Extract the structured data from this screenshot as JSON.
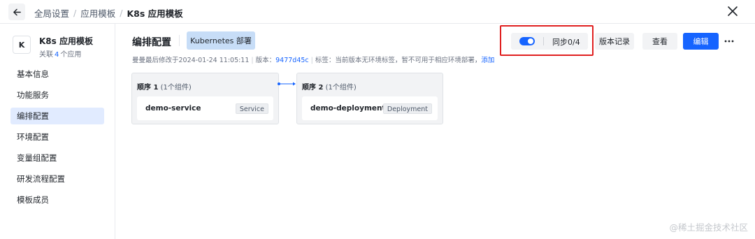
{
  "header": {
    "breadcrumbs": [
      "全局设置",
      "应用模板"
    ],
    "current": "K8s 应用模板",
    "back_icon": "arrow-left-icon",
    "close_icon": "close-icon"
  },
  "sidebar": {
    "app_avatar_letter": "K",
    "app_name": "K8s 应用模板",
    "app_meta_prefix": "关联",
    "app_meta_count": "4",
    "app_meta_suffix": "个应用",
    "items": [
      {
        "label": "基本信息",
        "active": false
      },
      {
        "label": "功能服务",
        "active": false
      },
      {
        "label": "编排配置",
        "active": true
      },
      {
        "label": "环境配置",
        "active": false
      },
      {
        "label": "变量组配置",
        "active": false
      },
      {
        "label": "研发流程配置",
        "active": false
      },
      {
        "label": "模板成员",
        "active": false
      }
    ]
  },
  "main": {
    "title": "编排配置",
    "tag": "Kubernetes 部署",
    "meta": {
      "modified": "曼曼最后修改于2024-01-24 11:05:11",
      "version_label": "版本：",
      "version_value": "9477d45c",
      "tags_label": "标签：",
      "tags_text": "当前版本无环境标签，暂不可用于相应环境部署，",
      "add_link": "添加"
    },
    "toolbar": {
      "sync_enabled": true,
      "sync_label": "同步0/4",
      "history_label": "版本记录",
      "view_label": "查看",
      "edit_label": "编辑",
      "more_icon": "more-horizontal-icon"
    },
    "stages": [
      {
        "title": "顺序 1",
        "count": "(1个组件)",
        "component": "demo-service",
        "kind": "Service"
      },
      {
        "title": "顺序 2",
        "count": "(1个组件)",
        "component": "demo-deployment",
        "kind": "Deployment"
      }
    ]
  },
  "watermark": "@稀土掘金技术社区",
  "colors": {
    "accent": "#1664ff",
    "highlight_border": "#e02020",
    "active_nav_bg": "#e1ebff",
    "tag_bg": "#c7ddf7"
  }
}
